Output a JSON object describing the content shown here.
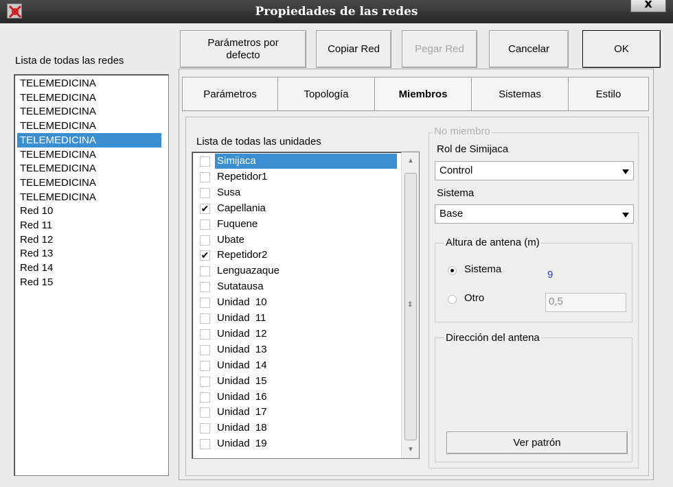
{
  "window": {
    "title": "Propiedades de las redes",
    "close_label": "x"
  },
  "networks": {
    "heading": "Lista de todas las redes",
    "items": [
      "TELEMEDICINA",
      "TELEMEDICINA",
      "TELEMEDICINA",
      "TELEMEDICINA",
      "TELEMEDICINA",
      "TELEMEDICINA",
      "TELEMEDICINA",
      "TELEMEDICINA",
      "TELEMEDICINA",
      "Red 10",
      "Red 11",
      "Red 12",
      "Red 13",
      "Red 14",
      "Red 15"
    ],
    "selected_index": 4
  },
  "toolbar": {
    "defaults_line1": "Parámetros por",
    "defaults_line2": "defecto",
    "copy": "Copiar Red",
    "paste": "Pegar Red",
    "cancel": "Cancelar",
    "ok": "OK"
  },
  "tabs": [
    "Parámetros",
    "Topología",
    "Miembros",
    "Sistemas",
    "Estilo"
  ],
  "active_tab": "Miembros",
  "units": {
    "heading": "Lista de todas las unidades",
    "items": [
      {
        "name": "Simijaca",
        "checked": false,
        "selected": true
      },
      {
        "name": "Repetidor1",
        "checked": false
      },
      {
        "name": "Susa",
        "checked": false
      },
      {
        "name": "Capellania",
        "checked": true
      },
      {
        "name": "Fuquene",
        "checked": false
      },
      {
        "name": "Ubate",
        "checked": false
      },
      {
        "name": "Repetidor2",
        "checked": true
      },
      {
        "name": "Lenguazaque",
        "checked": false
      },
      {
        "name": "Sutatausa",
        "checked": false
      },
      {
        "name": "Unidad  10",
        "checked": false
      },
      {
        "name": "Unidad  11",
        "checked": false
      },
      {
        "name": "Unidad  12",
        "checked": false
      },
      {
        "name": "Unidad  13",
        "checked": false
      },
      {
        "name": "Unidad  14",
        "checked": false
      },
      {
        "name": "Unidad  15",
        "checked": false
      },
      {
        "name": "Unidad  16",
        "checked": false
      },
      {
        "name": "Unidad  17",
        "checked": false
      },
      {
        "name": "Unidad  18",
        "checked": false
      },
      {
        "name": "Unidad  19",
        "checked": false
      }
    ]
  },
  "member": {
    "group_label": "No miembro",
    "role_label": "Rol de Simijaca",
    "role_value": "Control",
    "system_label": "Sistema",
    "system_value": "Base",
    "antenna_height": {
      "label": "Altura de antena (m)",
      "option_system": "Sistema",
      "system_value": "9",
      "option_other": "Otro",
      "other_value": "0,5",
      "selected": "Sistema"
    },
    "antenna_direction": {
      "label": "Dirección del antena",
      "button": "Ver patrón"
    }
  },
  "colors": {
    "selection": "#3a8ed2",
    "system_value": "#1b3fd8"
  }
}
